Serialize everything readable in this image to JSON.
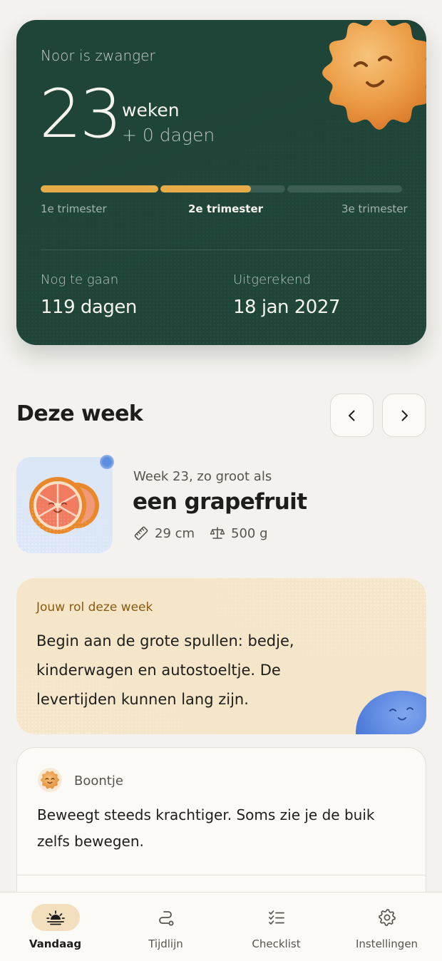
{
  "hero": {
    "label": "Noor is zwanger",
    "weeks": "23",
    "weeks_unit": "weken",
    "days": "+ 0 dagen",
    "progress_fraction": 0.575,
    "trimesters": [
      "1e trimester",
      "2e trimester",
      "3e trimester"
    ],
    "active_trimester": 1,
    "remaining_label": "Nog te gaan",
    "remaining_value": "119 dagen",
    "due_label": "Uitgerekend",
    "due_value": "18 jan 2027",
    "colors": {
      "card": "#1f4438",
      "accent": "#e8ab4a",
      "sun": "#e89a3c"
    }
  },
  "week": {
    "title": "Deze week",
    "prev_icon": "chevron-left-icon",
    "next_icon": "chevron-right-icon",
    "size_intro": "Week 23, zo groot als",
    "size_name": "een grapefruit",
    "length": "29 cm",
    "weight": "500 g",
    "length_icon": "ruler-icon",
    "weight_icon": "scale-icon"
  },
  "role": {
    "label": "Jouw rol deze week",
    "text": "Begin aan de grote spullen: bedje, kinderwagen en autostoeltje. De levertijden kunnen lang zijn."
  },
  "baby": {
    "name": "Boontje",
    "text": "Beweegt steeds krachtiger. Soms zie je de buik zelfs bewegen."
  },
  "tabs": [
    {
      "label": "Vandaag",
      "icon": "sunrise-icon",
      "active": true
    },
    {
      "label": "Tijdlijn",
      "icon": "path-icon",
      "active": false
    },
    {
      "label": "Checklist",
      "icon": "checklist-icon",
      "active": false
    },
    {
      "label": "Instellingen",
      "icon": "gear-icon",
      "active": false
    }
  ]
}
